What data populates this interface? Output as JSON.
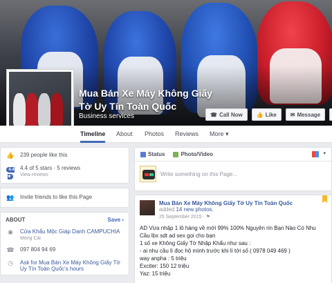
{
  "page": {
    "name": "Mua Bán Xe Máy Không Giấy Tờ Uy Tín Toàn Quốc",
    "category": "Business services"
  },
  "actions": {
    "call_now": "Call Now",
    "like": "Like",
    "message": "Message",
    "more_icon": "•••"
  },
  "nav": {
    "tabs": [
      {
        "label": "Timeline",
        "active": true
      },
      {
        "label": "About"
      },
      {
        "label": "Photos"
      },
      {
        "label": "Reviews"
      },
      {
        "label": "More ▾"
      }
    ]
  },
  "stats": {
    "likes": "239 people like this",
    "rating_badge": "4.4 ★",
    "rating": "4.4 of 5 stars · 5 reviews",
    "view_reviews": "View reviews"
  },
  "invite": "Invite friends to like this Page",
  "about": {
    "heading": "ABOUT",
    "edit": "Save",
    "address": "Cửa Khẩu Mộc Giáp Danh CAMPUCHIA",
    "city": "Móng Cái",
    "phone": "097 804 94 69",
    "hours_link": "Ask for Mua Bán Xe Máy Không Giấy Tờ Uy Tín Toàn Quốc's hours"
  },
  "composer": {
    "status": "Status",
    "photo_video": "Photo/Video",
    "placeholder": "Write something on this Page..."
  },
  "post": {
    "author": "Mua Bán Xe Máy Không Giấy Tờ Uy Tín Toàn Quốc",
    "added": "added",
    "photos": "14 new photos.",
    "date": "25 September 2015 · ⚑",
    "lines": [
      "AD Vừa nhập 1 lô hàng về mới 99% 100% Nguyên rin Bạn Nào Có Nhu",
      "Cầu lbx sdt ad sex gọi cho bạn",
      "1 số xe Không Giấy Tờ Nhập Khẩu như sau :",
      "- ai nhu cầu lì đọc hộ mình trước khi lì tới số ( 0978 049 469 )",
      "way anpha : 5 triệu",
      "Exciter: 150 12 triệu",
      "Yaz: 15 triệu"
    ]
  }
}
